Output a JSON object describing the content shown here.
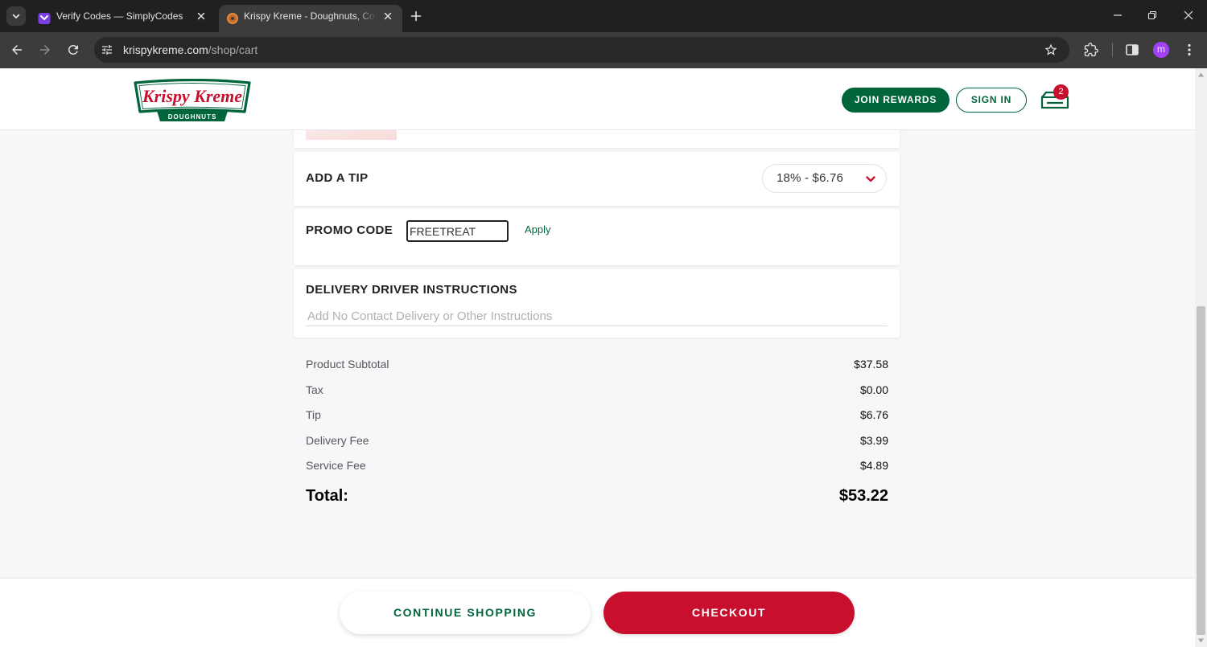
{
  "browser": {
    "tabs": [
      {
        "title": "Verify Codes — SimplyCodes",
        "favicon": "simplycodes-icon"
      },
      {
        "title": "Krispy Kreme - Doughnuts, Coff",
        "favicon": "krispy-kreme-donut-icon"
      }
    ],
    "url": {
      "domain": "krispykreme.com",
      "path": "/shop/cart"
    },
    "profile_initial": "m",
    "icons": [
      "chevron-down-icon",
      "close-icon",
      "plus-icon",
      "minimize-icon",
      "restore-icon",
      "back-arrow-icon",
      "forward-arrow-icon",
      "reload-icon",
      "site-info-icon",
      "star-icon",
      "extensions-icon",
      "side-panel-icon",
      "more-menu-icon"
    ]
  },
  "header": {
    "logo": {
      "brand": "Krispy Kreme",
      "tagline": "DOUGHNUTS"
    },
    "join_rewards_label": "JOIN REWARDS",
    "sign_in_label": "SIGN IN",
    "cart_count": "2",
    "cart_icon": "cart-icon"
  },
  "cart": {
    "tip": {
      "label": "ADD A TIP",
      "selected": "18% - $6.76"
    },
    "promo": {
      "label": "PROMO CODE",
      "value": "FREETREAT",
      "apply_label": "Apply"
    },
    "delivery": {
      "label": "DELIVERY DRIVER INSTRUCTIONS",
      "placeholder": "Add No Contact Delivery or Other Instructions"
    },
    "summary": [
      {
        "label": "Product Subtotal",
        "value": "$37.58"
      },
      {
        "label": "Tax",
        "value": "$0.00"
      },
      {
        "label": "Tip",
        "value": "$6.76"
      },
      {
        "label": "Delivery Fee",
        "value": "$3.99"
      },
      {
        "label": "Service Fee",
        "value": "$4.89"
      }
    ],
    "total": {
      "label": "Total:",
      "value": "$53.22"
    }
  },
  "footer": {
    "continue_label": "CONTINUE SHOPPING",
    "checkout_label": "CHECKOUT"
  },
  "theme": {
    "brand_green": "#00653a",
    "brand_red": "#c8102e",
    "avatar": "#a142f4"
  }
}
